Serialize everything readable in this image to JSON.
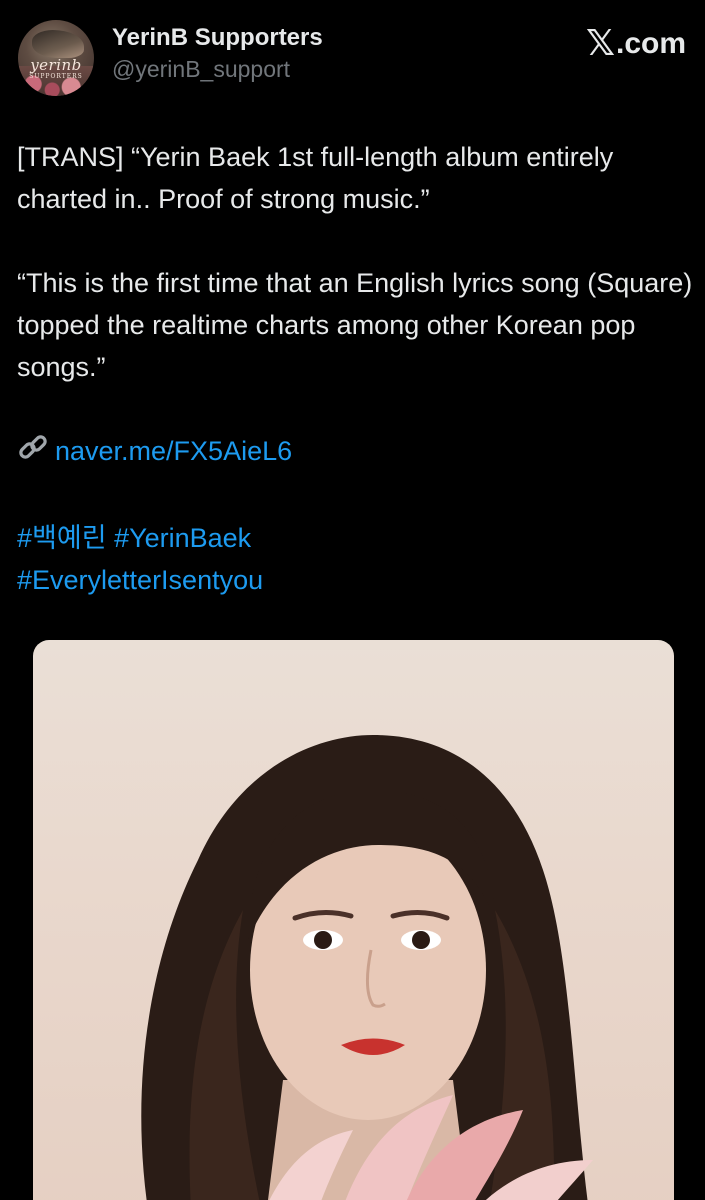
{
  "author": {
    "display_name": "YerinB Supporters",
    "handle": "@yerinB_support",
    "avatar_text": "yerinb",
    "avatar_subtext": "SUPPORTERS"
  },
  "brand": {
    "label": "com",
    "icon": "x-logo-icon"
  },
  "tweet": {
    "paragraph_1": "[TRANS] “Yerin Baek 1st full-length album entirely charted in.. Proof of strong music.”",
    "paragraph_2": "“This is the first time that an English lyrics song (Square) topped the realtime charts among other Korean pop songs.”",
    "link_icon": "link-icon",
    "link_text": "naver.me/FX5AieL6",
    "hashtags": [
      "#백예린",
      "#YerinBaek",
      "#EveryletterIsentyou"
    ]
  },
  "colors": {
    "background": "#000000",
    "text": "#e7e9ea",
    "secondary_text": "#71767b",
    "link": "#1d9bf0"
  }
}
